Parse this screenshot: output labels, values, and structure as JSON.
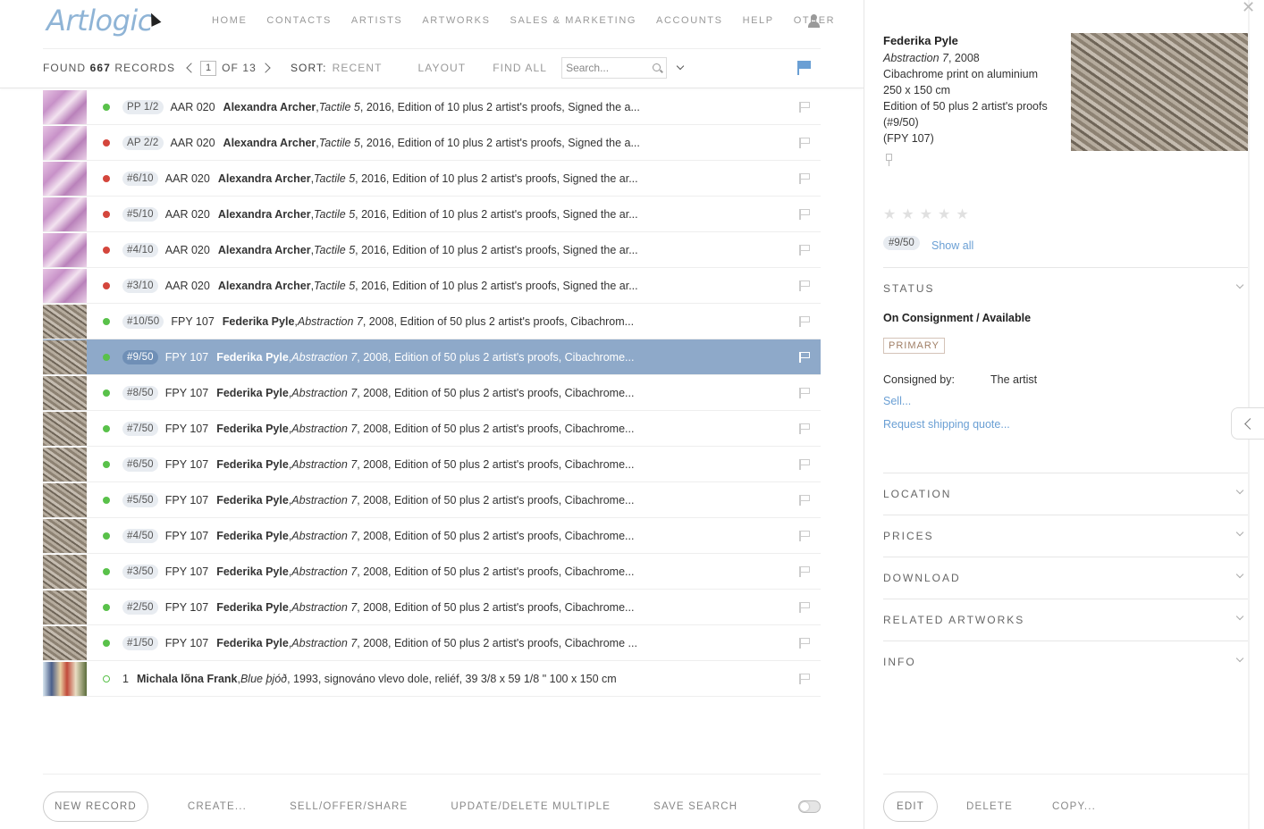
{
  "app": {
    "logo": "Artlogic"
  },
  "nav": [
    "HOME",
    "CONTACTS",
    "ARTISTS",
    "ARTWORKS",
    "SALES & MARKETING",
    "ACCOUNTS",
    "HELP",
    "OTHER"
  ],
  "toolbar": {
    "found_prefix": "FOUND",
    "found_count": "667",
    "found_suffix": "RECORDS",
    "page": "1",
    "page_of": "OF 13",
    "sort_label": "SORT:",
    "sort_value": "RECENT",
    "layout": "LAYOUT",
    "find_all": "FIND ALL",
    "search_placeholder": "Search..."
  },
  "rows": [
    {
      "thumb": "pink",
      "status": "green",
      "edition": "PP 1/2",
      "code": "AAR 020",
      "artist": "Alexandra Archer",
      "title": "Tactile 5",
      "details": ", 2016, Edition of 10 plus 2 artist's proofs, Signed the a...",
      "selected": false
    },
    {
      "thumb": "pink",
      "status": "red",
      "edition": "AP 2/2",
      "code": "AAR 020",
      "artist": "Alexandra Archer",
      "title": "Tactile 5",
      "details": ", 2016, Edition of 10 plus 2 artist's proofs, Signed the a...",
      "selected": false
    },
    {
      "thumb": "pink",
      "status": "red",
      "edition": "#6/10",
      "code": "AAR 020",
      "artist": "Alexandra Archer",
      "title": "Tactile 5",
      "details": ", 2016, Edition of 10 plus 2 artist's proofs, Signed the ar...",
      "selected": false
    },
    {
      "thumb": "pink",
      "status": "red",
      "edition": "#5/10",
      "code": "AAR 020",
      "artist": "Alexandra Archer",
      "title": "Tactile 5",
      "details": ", 2016, Edition of 10 plus 2 artist's proofs, Signed the ar...",
      "selected": false
    },
    {
      "thumb": "pink",
      "status": "red",
      "edition": "#4/10",
      "code": "AAR 020",
      "artist": "Alexandra Archer",
      "title": "Tactile 5",
      "details": ", 2016, Edition of 10 plus 2 artist's proofs, Signed the ar...",
      "selected": false
    },
    {
      "thumb": "pink",
      "status": "red",
      "edition": "#3/10",
      "code": "AAR 020",
      "artist": "Alexandra Archer",
      "title": "Tactile 5",
      "details": ", 2016, Edition of 10 plus 2 artist's proofs, Signed the ar...",
      "selected": false
    },
    {
      "thumb": "stone",
      "status": "green",
      "edition": "#10/50",
      "code": "FPY 107",
      "artist": "Federika Pyle",
      "title": "Abstraction 7",
      "details": ", 2008, Edition of 50 plus 2 artist's proofs, Cibachrom...",
      "selected": false
    },
    {
      "thumb": "stone",
      "status": "green",
      "edition": "#9/50",
      "code": "FPY 107",
      "artist": "Federika Pyle",
      "title": "Abstraction 7",
      "details": ", 2008, Edition of 50 plus 2 artist's proofs, Cibachrome...",
      "selected": true
    },
    {
      "thumb": "stone",
      "status": "green",
      "edition": "#8/50",
      "code": "FPY 107",
      "artist": "Federika Pyle",
      "title": "Abstraction 7",
      "details": ", 2008, Edition of 50 plus 2 artist's proofs, Cibachrome...",
      "selected": false
    },
    {
      "thumb": "stone",
      "status": "green",
      "edition": "#7/50",
      "code": "FPY 107",
      "artist": "Federika Pyle",
      "title": "Abstraction 7",
      "details": ", 2008, Edition of 50 plus 2 artist's proofs, Cibachrome...",
      "selected": false
    },
    {
      "thumb": "stone",
      "status": "green",
      "edition": "#6/50",
      "code": "FPY 107",
      "artist": "Federika Pyle",
      "title": "Abstraction 7",
      "details": ", 2008, Edition of 50 plus 2 artist's proofs, Cibachrome...",
      "selected": false
    },
    {
      "thumb": "stone",
      "status": "green",
      "edition": "#5/50",
      "code": "FPY 107",
      "artist": "Federika Pyle",
      "title": "Abstraction 7",
      "details": ", 2008, Edition of 50 plus 2 artist's proofs, Cibachrome...",
      "selected": false
    },
    {
      "thumb": "stone",
      "status": "green",
      "edition": "#4/50",
      "code": "FPY 107",
      "artist": "Federika Pyle",
      "title": "Abstraction 7",
      "details": ", 2008, Edition of 50 plus 2 artist's proofs, Cibachrome...",
      "selected": false
    },
    {
      "thumb": "stone",
      "status": "green",
      "edition": "#3/50",
      "code": "FPY 107",
      "artist": "Federika Pyle",
      "title": "Abstraction 7",
      "details": ", 2008, Edition of 50 plus 2 artist's proofs, Cibachrome...",
      "selected": false
    },
    {
      "thumb": "stone",
      "status": "green",
      "edition": "#2/50",
      "code": "FPY 107",
      "artist": "Federika Pyle",
      "title": "Abstraction 7",
      "details": ", 2008, Edition of 50 plus 2 artist's proofs, Cibachrome...",
      "selected": false
    },
    {
      "thumb": "stone",
      "status": "green",
      "edition": "#1/50",
      "code": "FPY 107",
      "artist": "Federika Pyle",
      "title": "Abstraction 7",
      "details": ", 2008, Edition of 50 plus 2 artist's proofs, Cibachrome ...",
      "selected": false
    },
    {
      "thumb": "paint",
      "status": "outline",
      "edition": "",
      "code": "1",
      "artist": "Michala lõna Frank",
      "title": "Blue þjóð",
      "details": ", 1993, signováno vlevo dole, reliéf, 39 3/8 x 59 1/8 \" 100 x 150 cm",
      "selected": false
    }
  ],
  "bottom": {
    "new_record": "NEW RECORD",
    "create": "CREATE...",
    "sell": "SELL/OFFER/SHARE",
    "update": "UPDATE/DELETE MULTIPLE",
    "save_search": "SAVE SEARCH"
  },
  "panel": {
    "artist": "Federika Pyle",
    "title": "Abstraction 7",
    "year": ", 2008",
    "medium": "Cibachrome print on aluminium",
    "dimensions": "250 x 150 cm",
    "edition_info": "Edition of 50 plus 2 artist's proofs",
    "edition_num": "(#9/50)",
    "stock": "(FPY 107)",
    "edition_badge": "#9/50",
    "show_all": "Show all",
    "status_header": "STATUS",
    "status_value": "On Consignment / Available",
    "primary": "PRIMARY",
    "consigned_label": "Consigned by:",
    "consigned_value": "The artist",
    "sell_link": "Sell...",
    "shipping_link": "Request shipping quote...",
    "sections": [
      "LOCATION",
      "PRICES",
      "DOWNLOAD",
      "RELATED ARTWORKS",
      "INFO"
    ],
    "edit": "EDIT",
    "delete": "DELETE",
    "copy": "COPY..."
  }
}
